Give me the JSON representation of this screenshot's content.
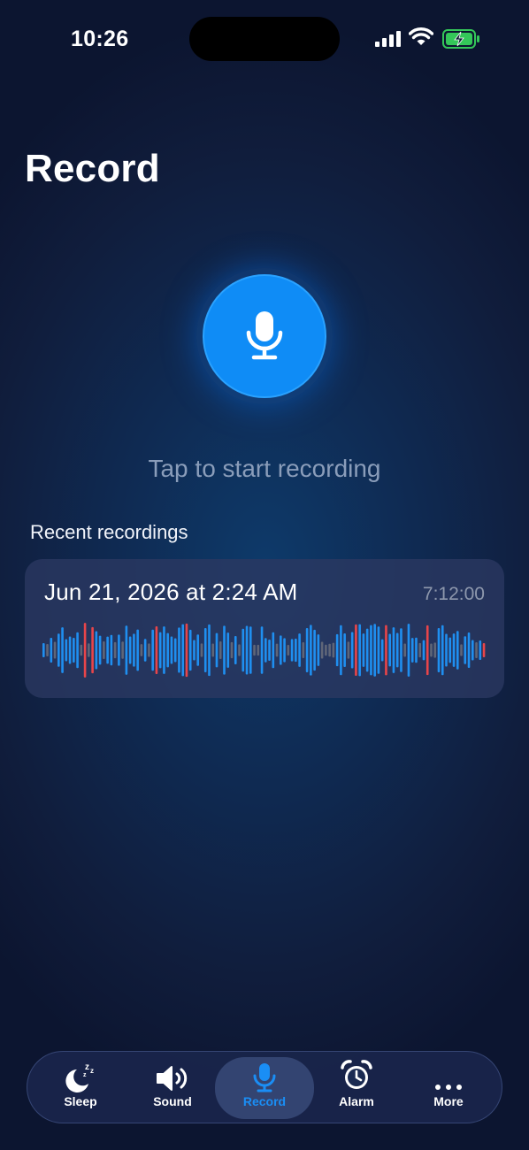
{
  "status_bar": {
    "time": "10:26",
    "icons": [
      "signal-icon",
      "wifi-icon",
      "battery-charging-icon"
    ]
  },
  "page": {
    "title": "Record"
  },
  "record": {
    "icon": "microphone-icon",
    "hint": "Tap to start recording",
    "accent_color": "#0f8cf6"
  },
  "recent": {
    "title": "Recent recordings",
    "items": [
      {
        "date": "Jun 21, 2026 at 2:24 AM",
        "duration": "7:12:00",
        "waveform_colors": {
          "quiet": "#5f6678",
          "normal": "#1f8ff0",
          "loud": "#e8454a"
        }
      }
    ]
  },
  "tab_bar": {
    "tabs": [
      {
        "label": "Sleep",
        "icon": "moon-zzz-icon"
      },
      {
        "label": "Sound",
        "icon": "speaker-icon"
      },
      {
        "label": "Record",
        "icon": "microphone-icon",
        "active": true
      },
      {
        "label": "Alarm",
        "icon": "alarm-clock-icon"
      },
      {
        "label": "More",
        "icon": "more-dots-icon"
      }
    ]
  }
}
